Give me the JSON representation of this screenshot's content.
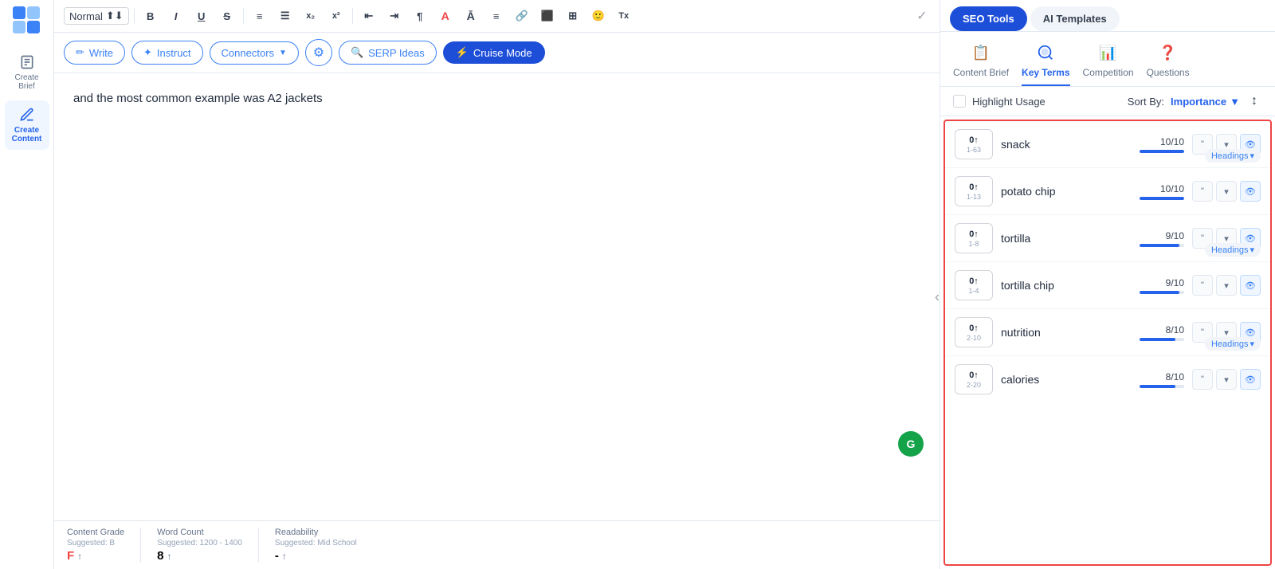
{
  "sidebar": {
    "items": [
      {
        "label": "Create\nBrief",
        "active": false,
        "icon": "document-icon"
      },
      {
        "label": "Create\nContent",
        "active": true,
        "icon": "edit-icon"
      }
    ]
  },
  "toolbar": {
    "format_select": "Normal",
    "buttons": [
      "B",
      "I",
      "U",
      "S",
      "ol",
      "ul",
      "x₂",
      "x²",
      "←",
      "→",
      "¶",
      "A",
      "Ā",
      "≡",
      "🔗",
      "⬛",
      "⊞",
      "🙂",
      "Tx"
    ],
    "check_icon": "✓"
  },
  "actionbar": {
    "write_label": "Write",
    "instruct_label": "Instruct",
    "connectors_label": "Connectors",
    "settings_label": "⚙",
    "serp_label": "SERP Ideas",
    "cruise_label": "Cruise Mode"
  },
  "editor": {
    "content": "and the most common example was A2 jackets"
  },
  "bottombar": {
    "grade_label": "Content Grade",
    "grade_suggested": "Suggested: B",
    "grade_value": "F",
    "wordcount_label": "Word Count",
    "wordcount_suggested": "Suggested: 1200 - 1400",
    "wordcount_value": "8",
    "readability_label": "Readability",
    "readability_suggested": "Suggested: Mid School",
    "readability_value": "-"
  },
  "rightpanel": {
    "seo_tools_label": "SEO Tools",
    "ai_templates_label": "AI Templates",
    "nav_items": [
      {
        "label": "Content Brief",
        "icon": "📋",
        "active": false
      },
      {
        "label": "Key Terms",
        "icon": "🔍",
        "active": true
      },
      {
        "label": "Competition",
        "icon": "📊",
        "active": false
      },
      {
        "label": "Questions",
        "icon": "❓",
        "active": false
      }
    ],
    "highlight_usage_label": "Highlight Usage",
    "sort_by_label": "Sort By:",
    "sort_value": "Importance",
    "keywords": [
      {
        "score_top": "0↑",
        "score_range": "1-63",
        "name": "snack",
        "fraction": "10/10",
        "bar_pct": 100,
        "headings": true
      },
      {
        "score_top": "0↑",
        "score_range": "1-13",
        "name": "potato chip",
        "fraction": "10/10",
        "bar_pct": 100,
        "headings": false
      },
      {
        "score_top": "0↑",
        "score_range": "1-8",
        "name": "tortilla",
        "fraction": "9/10",
        "bar_pct": 90,
        "headings": true
      },
      {
        "score_top": "0↑",
        "score_range": "1-4",
        "name": "tortilla chip",
        "fraction": "9/10",
        "bar_pct": 90,
        "headings": false
      },
      {
        "score_top": "0↑",
        "score_range": "2-10",
        "name": "nutrition",
        "fraction": "8/10",
        "bar_pct": 80,
        "headings": true
      },
      {
        "score_top": "0↑",
        "score_range": "2-20",
        "name": "calories",
        "fraction": "8/10",
        "bar_pct": 80,
        "headings": false
      }
    ],
    "headings_label": "Headings"
  }
}
